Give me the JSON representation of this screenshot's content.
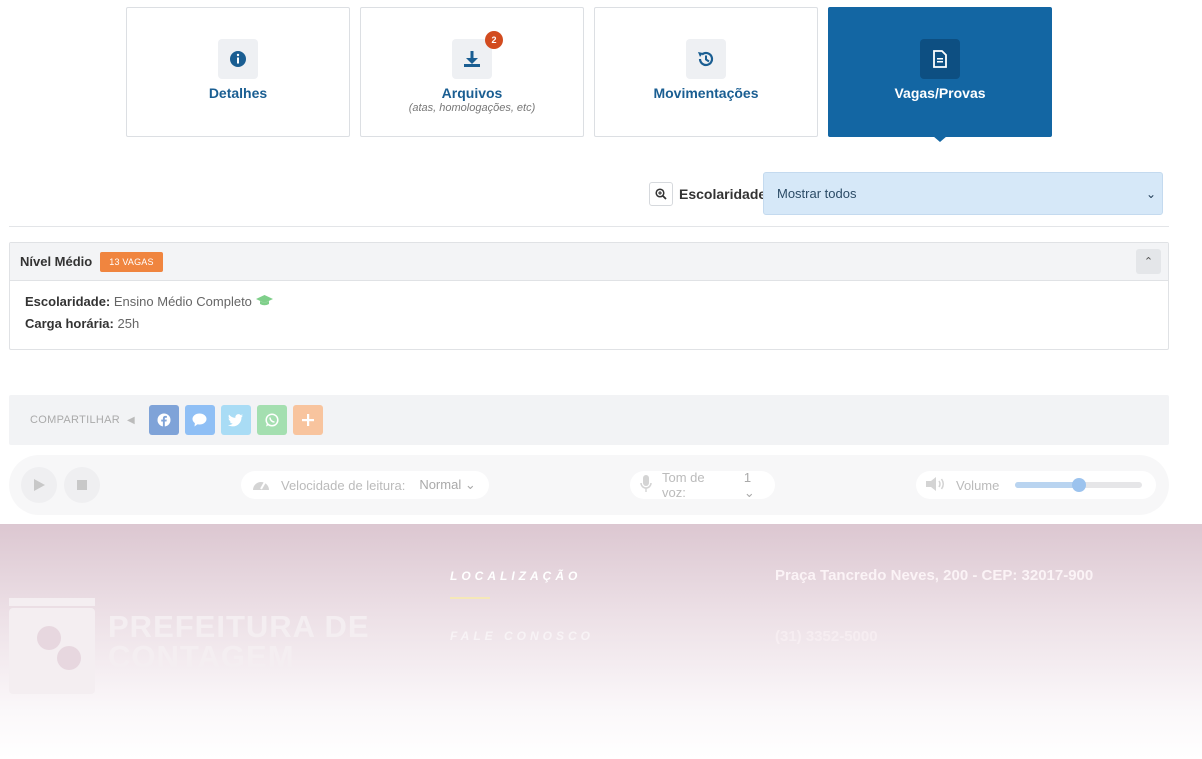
{
  "tabs": [
    {
      "label": "Detalhes",
      "sub": "",
      "icon": "info-icon"
    },
    {
      "label": "Arquivos",
      "sub": "(atas, homologações, etc)",
      "icon": "download-icon",
      "badge": "2"
    },
    {
      "label": "Movimentações",
      "sub": "",
      "icon": "history-icon"
    },
    {
      "label": "Vagas/Provas",
      "sub": "",
      "icon": "document-icon",
      "active": true
    }
  ],
  "filter": {
    "label": "Escolaridade",
    "selected": "Mostrar todos"
  },
  "card": {
    "title": "Nível Médio",
    "badge": "13 VAGAS",
    "rows": [
      {
        "key": "Escolaridade:",
        "value": "Ensino Médio Completo"
      },
      {
        "key": "Carga horária:",
        "value": "25h"
      }
    ]
  },
  "share": {
    "label": "COMPARTILHAR",
    "buttons": [
      "facebook-icon",
      "messenger-icon",
      "twitter-icon",
      "whatsapp-icon",
      "plus-icon"
    ]
  },
  "player": {
    "speed_label": "Velocidade de leitura:",
    "speed_value": "Normal",
    "tone_label": "Tom de voz:",
    "tone_value": "1",
    "volume_label": "Volume",
    "volume_level": 0.5
  },
  "footer": {
    "logo_line1": "PREFEITURA DE",
    "logo_line2": "CONTAGEM",
    "links": [
      "LOCALIZAÇÃO",
      "FALE CONOSCO"
    ],
    "address": "Praça Tancredo Neves, 200 - CEP: 32017-900",
    "phone": "(31) 3352-5000"
  },
  "colors": {
    "primary": "#1366a3",
    "badge": "#f0853f",
    "select_bg": "#d6e8f8"
  }
}
